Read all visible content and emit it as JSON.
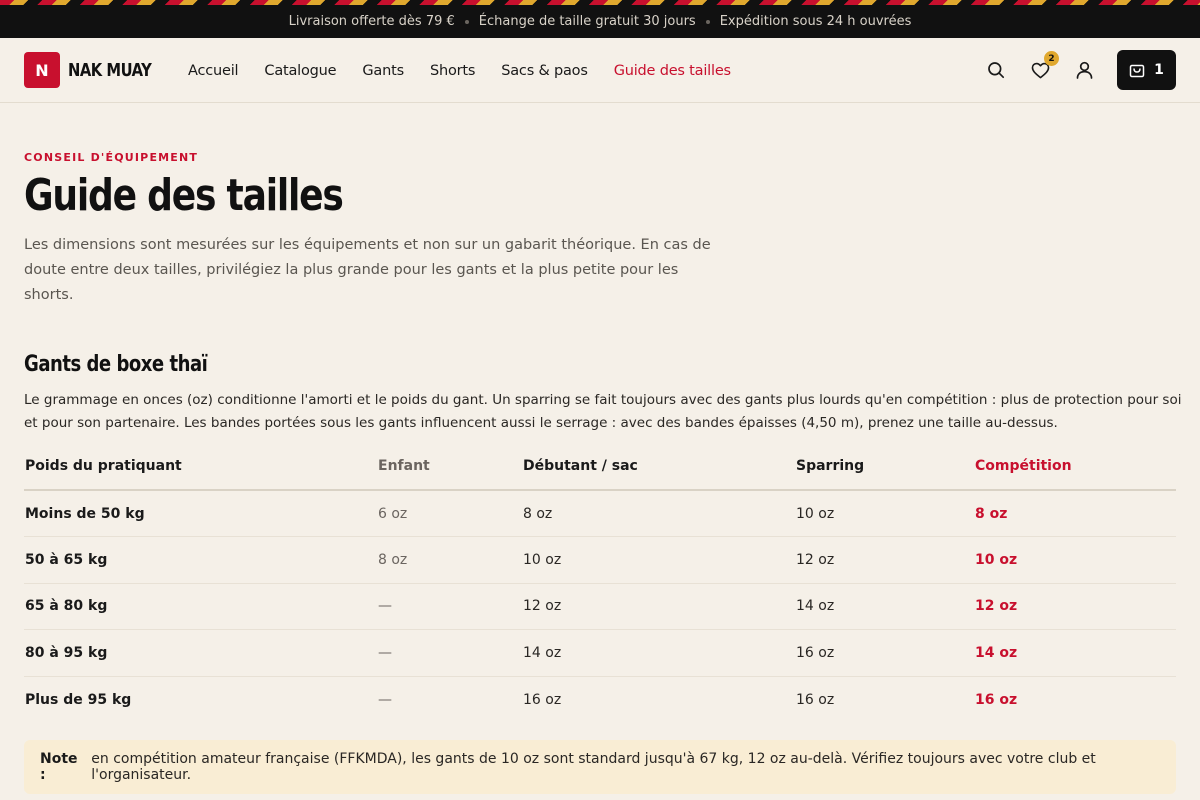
{
  "announcement": {
    "messages": [
      "Livraison offerte dès 79 €",
      "Échange de taille gratuit 30 jours",
      "Expédition sous 24 h ouvrées"
    ]
  },
  "header": {
    "logo_mark": "N",
    "logo_text": "NAK MUAY",
    "nav": [
      "Accueil",
      "Catalogue",
      "Gants",
      "Shorts",
      "Sacs & paos",
      "Guide des tailles"
    ],
    "active_nav": "Guide des tailles",
    "wishlist_count": "2",
    "cart_count": "1",
    "icons": [
      "search-icon",
      "heart-icon",
      "user-icon",
      "shopping-bag-icon"
    ]
  },
  "page": {
    "eyebrow": "CONSEIL D'ÉQUIPEMENT",
    "title": "Guide des tailles",
    "intro": "Les dimensions sont mesurées sur les équipements et non sur un gabarit théorique. En cas de doute entre deux tailles, privilégiez la plus grande pour les gants et la plus petite pour les shorts."
  },
  "gloves": {
    "title": "Gants de boxe thaï",
    "description": "Le grammage en onces (oz) conditionne l'amorti et le poids du gant. Un sparring se fait toujours avec des gants plus lourds qu'en compétition : plus de protection pour soi et pour son partenaire. Les bandes portées sous les gants influencent aussi le serrage : avec des bandes épaisses (4,50 m), prenez une taille au-dessus.",
    "columns": [
      "Poids du pratiquant",
      "Enfant",
      "Débutant / sac",
      "Sparring",
      "Compétition"
    ],
    "rows": [
      [
        "Moins de 50 kg",
        "6 oz",
        "8 oz",
        "10 oz",
        "8 oz"
      ],
      [
        "50 à 65 kg",
        "8 oz",
        "10 oz",
        "12 oz",
        "10 oz"
      ],
      [
        "65 à 80 kg",
        "—",
        "12 oz",
        "14 oz",
        "12 oz"
      ],
      [
        "80 à 95 kg",
        "—",
        "14 oz",
        "16 oz",
        "14 oz"
      ],
      [
        "Plus de 95 kg",
        "—",
        "16 oz",
        "16 oz",
        "16 oz"
      ]
    ]
  },
  "note": {
    "label": "Note :",
    "text": "en compétition amateur française (FFKMDA), les gants de 10 oz sont standard jusqu'à 67 kg, 12 oz au-delà. Vérifiez toujours avec votre club et l'organisateur."
  },
  "colors": {
    "accent": "#c8102e",
    "gold": "#e0a82e",
    "dark": "#111111",
    "background": "#f5f0e8"
  }
}
